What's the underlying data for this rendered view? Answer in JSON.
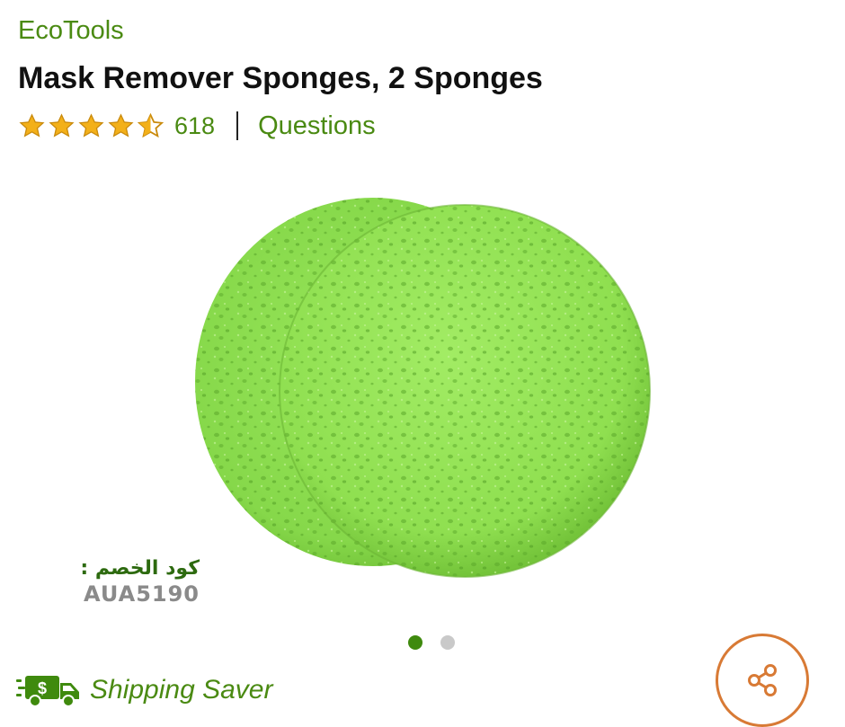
{
  "product": {
    "brand": "EcoTools",
    "title": "Mask Remover Sponges, 2 Sponges",
    "rating": 4.5,
    "rating_max": 5,
    "review_count": "618",
    "questions_label": "Questions"
  },
  "gallery": {
    "image_name": "green-sponges",
    "current_index": 1,
    "total_images": 2
  },
  "coupon": {
    "label": "كود الخصم :",
    "code": "AUA5190"
  },
  "shipping": {
    "label": "Shipping Saver",
    "icon": "delivery-truck-icon"
  },
  "actions": {
    "share_icon": "share-icon"
  },
  "colors": {
    "brand_green": "#4a8a12",
    "star": "#f3b019",
    "share_accent": "#d87a35",
    "dot_active": "#3f8a0e",
    "dot_inactive": "#c9c9c9"
  }
}
